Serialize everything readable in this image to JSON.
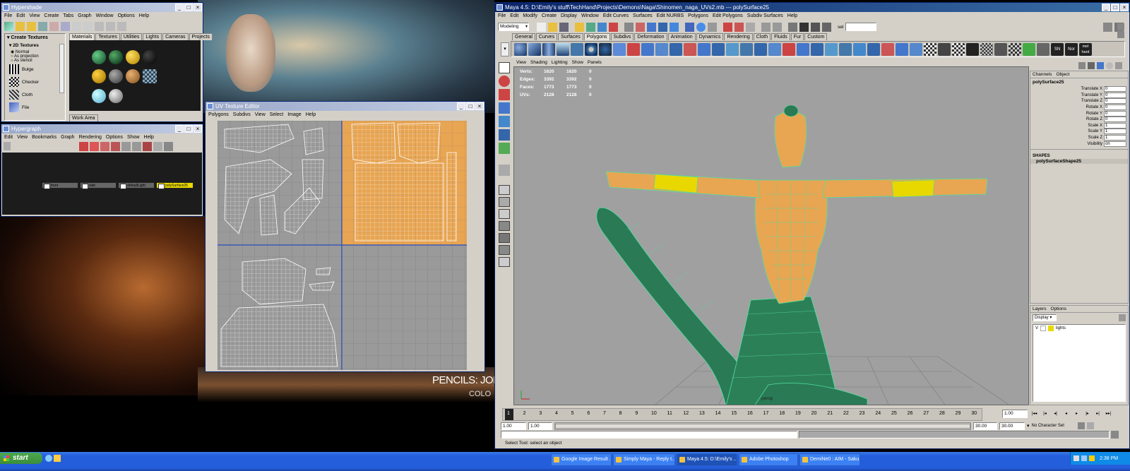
{
  "colors": {
    "accent": "#e8a552",
    "mesh": "#4fe0a0",
    "highlight": "#e8d800",
    "title_active": "#0a246a",
    "taskbar": "#245edb"
  },
  "background": {
    "credit_text": "PENCILS: JOE",
    "credit_text2": "COLO"
  },
  "hypershade": {
    "title": "Hypershade",
    "menu": [
      "File",
      "Edit",
      "View",
      "Create",
      "Tabs",
      "Graph",
      "Window",
      "Options",
      "Help"
    ],
    "create_header": "Create Textures",
    "section": "2D Textures",
    "radio": [
      "Normal",
      "As projection",
      "As stencil"
    ],
    "textures": [
      "Bulge",
      "Checker",
      "Cloth",
      "File"
    ],
    "tabs": [
      "Materials",
      "Textures",
      "Utilities",
      "Lights",
      "Cameras",
      "Projects"
    ],
    "work_tab": "Work Area"
  },
  "hypergraph": {
    "title": "Hypergraph",
    "menu": [
      "Edit",
      "View",
      "Bookmarks",
      "Graph",
      "Rendering",
      "Options",
      "Show",
      "Help"
    ],
    "nodes": [
      "front",
      "side",
      "defaultLight",
      "polySurface25"
    ]
  },
  "uv_editor": {
    "title": "UV Texture Editor",
    "menu": [
      "Polygons",
      "Subdivs",
      "View",
      "Select",
      "Image",
      "Help"
    ]
  },
  "maya": {
    "title": "Maya 4.5: D:\\Emily's stuff\\TechHand\\Projects\\Demons\\Naga\\Shinomen_naga_UVs2.mb  ---  polySurface25",
    "menu": [
      "File",
      "Edit",
      "Modify",
      "Create",
      "Display",
      "Window",
      "Edit Curves",
      "Surfaces",
      "Edit NURBS",
      "Polygons",
      "Edit Polygons",
      "Subdiv Surfaces",
      "Help"
    ],
    "mode": "Modeling",
    "sel_label": "sel",
    "shelf_tabs": [
      "General",
      "Curves",
      "Surfaces",
      "Polygons",
      "Subdivs",
      "Deformation",
      "Animation",
      "Dynamics",
      "Rendering",
      "Cloth",
      "Fluids",
      "Fur",
      "Custom"
    ],
    "active_shelf": "Polygons",
    "shelf_text_icons": [
      "SN",
      "Nor",
      "mel\nhard"
    ],
    "panel_menu": [
      "View",
      "Shading",
      "Lighting",
      "Show",
      "Panels"
    ],
    "hud": [
      {
        "label": "Verts:",
        "a": "1620",
        "b": "1620",
        "c": "0"
      },
      {
        "label": "Edges:",
        "a": "3392",
        "b": "3392",
        "c": "0"
      },
      {
        "label": "Faces:",
        "a": "1773",
        "b": "1773",
        "c": "0"
      },
      {
        "label": "UVs:",
        "a": "2128",
        "b": "2128",
        "c": "0"
      }
    ],
    "camera": "persp",
    "channel_tabs": [
      "Channels",
      "Object"
    ],
    "object_name": "polySurface25",
    "channels": [
      {
        "name": "Translate X",
        "value": "0"
      },
      {
        "name": "Translate Y",
        "value": "0"
      },
      {
        "name": "Translate Z",
        "value": "0"
      },
      {
        "name": "Rotate X",
        "value": "0"
      },
      {
        "name": "Rotate Y",
        "value": "0"
      },
      {
        "name": "Rotate Z",
        "value": "0"
      },
      {
        "name": "Scale X",
        "value": "1"
      },
      {
        "name": "Scale Y",
        "value": "1"
      },
      {
        "name": "Scale Z",
        "value": "1"
      },
      {
        "name": "Visibility",
        "value": "on"
      }
    ],
    "shapes_header": "SHAPES",
    "shape_name": "polySurfaceShape25",
    "layers_tabs": [
      "Layers",
      "Options"
    ],
    "layers_display": "Display",
    "layer": {
      "v": "V",
      "name": "lights"
    },
    "timeline_ticks": [
      "1",
      "2",
      "3",
      "4",
      "5",
      "6",
      "7",
      "8",
      "9",
      "10",
      "11",
      "12",
      "13",
      "14",
      "15",
      "16",
      "17",
      "18",
      "19",
      "20",
      "21",
      "22",
      "23",
      "24",
      "25",
      "26",
      "27",
      "28",
      "29",
      "30"
    ],
    "current_frame": "1.00",
    "range_start": "1.00",
    "range_start2": "1.00",
    "range_end": "30.00",
    "range_end2": "30.00",
    "char_set": "No Character Set",
    "status": "Select Tool: select an object"
  },
  "taskbar": {
    "start": "start",
    "items": [
      "Google Image Result ...",
      "Simply Maya - Reply t...",
      "Maya 4.5: D:\\Emily's ...",
      "Adobe Photoshop",
      "DemiNe0 : AIM - Saku..."
    ],
    "clock": "2:38 PM"
  }
}
